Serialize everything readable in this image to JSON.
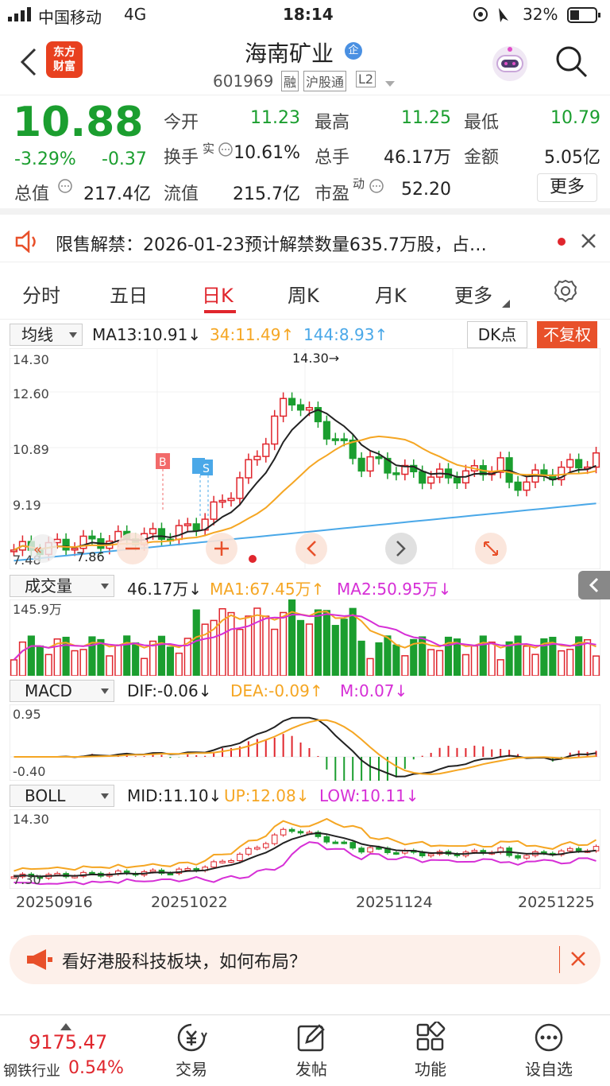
{
  "status": {
    "carrier": "中国移动",
    "network": "4G",
    "time": "18:14",
    "battery": "32%"
  },
  "nav": {
    "logo_line1": "东方",
    "logo_line2": "财富",
    "title": "海南矿业",
    "title_badge": "企",
    "code": "601969",
    "tags": [
      "融",
      "沪股通",
      "L2"
    ]
  },
  "quote": {
    "price": "10.88",
    "change_pct": "-3.29%",
    "change": "-0.37",
    "row1": [
      [
        "今开",
        "11.23"
      ],
      [
        "最高",
        "11.25"
      ],
      [
        "最低",
        "10.79"
      ]
    ],
    "row2": [
      [
        "换手",
        "10.61%"
      ],
      [
        "总手",
        "46.17万"
      ],
      [
        "金额",
        "5.05亿"
      ]
    ],
    "row2_sup": "实",
    "row3": [
      [
        "总值",
        "217.4亿"
      ],
      [
        "流值",
        "215.7亿"
      ],
      [
        "市盈",
        "52.20"
      ]
    ],
    "row3_sup": "动",
    "more_label": "更多"
  },
  "notice": {
    "text": "限售解禁：2026-01-23预计解禁数量635.7万股，占…"
  },
  "tabs": [
    "分时",
    "五日",
    "日K",
    "周K",
    "月K",
    "更多"
  ],
  "active_tab": "日K",
  "kline_header": {
    "type": "均线",
    "ma13": "MA13:10.91↓",
    "ma34": "34:11.49↑",
    "ma144": "144:8.93↑",
    "dk_label": "DK点",
    "fq_label": "不复权"
  },
  "kline_axis": [
    "14.30",
    "12.60",
    "10.89",
    "9.19",
    "7.48"
  ],
  "kline_annotations": {
    "high": "14.30→",
    "low": "7.86",
    "b_marker": "B",
    "s_marker": "S"
  },
  "volume_header": {
    "type": "成交量",
    "vol": "46.17万↓",
    "ma1": "MA1:67.45万↑",
    "ma2": "MA2:50.95万↓"
  },
  "volume_axis": [
    "145.9万"
  ],
  "macd_header": {
    "type": "MACD",
    "dif": "DIF:-0.06↓",
    "dea": "DEA:-0.09↑",
    "m": "M:0.07↓"
  },
  "macd_axis": [
    "0.95",
    "-0.40"
  ],
  "boll_header": {
    "type": "BOLL",
    "mid": "MID:11.10↓",
    "up": "UP:12.08↓",
    "low": "LOW:10.11↓"
  },
  "boll_axis": [
    "14.30",
    "7.30"
  ],
  "dates": [
    "20250916",
    "20251022",
    "20251124",
    "20251225"
  ],
  "promo": {
    "text": "看好港股科技板块，如何布局？"
  },
  "bottom": {
    "index_value": "9175.47",
    "index_name": "钢铁行业",
    "index_change": "0.54%",
    "items": [
      "交易",
      "发帖",
      "功能",
      "设自选"
    ]
  },
  "colors": {
    "up": "#e0262d",
    "down": "#1b9e2f",
    "ma13": "#222222",
    "ma34": "#f5a623",
    "ma144": "#4aa8e8",
    "ma2": "#d62fd6"
  }
}
